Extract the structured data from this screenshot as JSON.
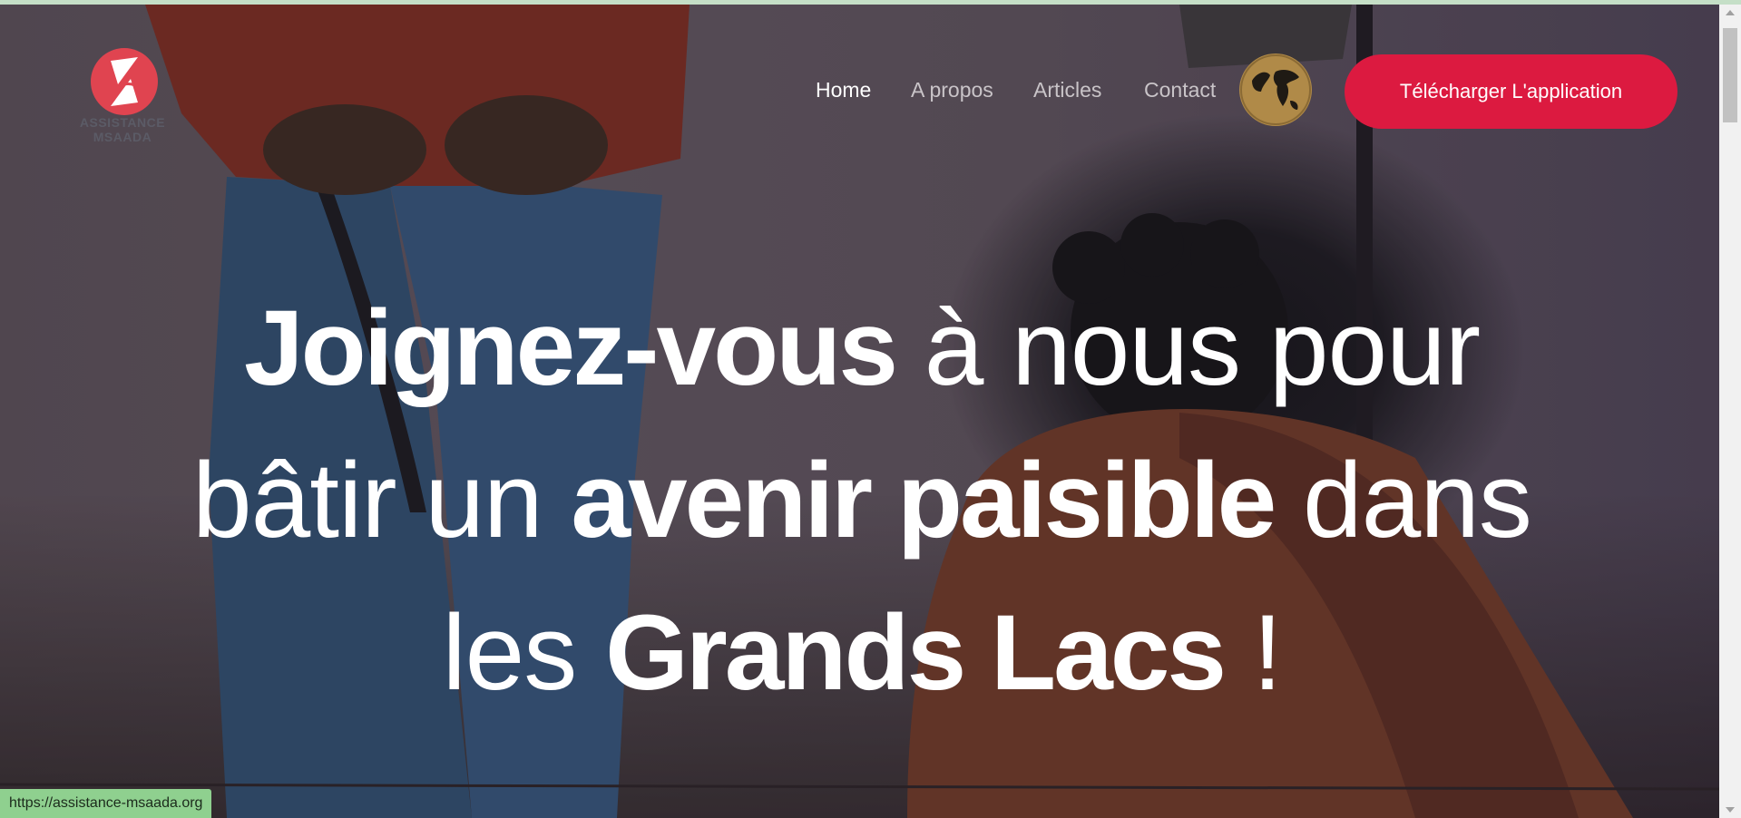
{
  "header": {
    "logo_text": "ASSISTANCE MSAADA",
    "nav": [
      {
        "label": "Home",
        "active": true
      },
      {
        "label": "A propos",
        "active": false
      },
      {
        "label": "Articles",
        "active": false
      },
      {
        "label": "Contact",
        "active": false
      }
    ],
    "language_icon": "globe-icon",
    "cta_label": "Télécharger L'application"
  },
  "hero": {
    "line1": {
      "bold": "Joignez-vous",
      "light": " à nous pour"
    },
    "line2": {
      "light_a": "bâtir un ",
      "bold": "avenir paisible",
      "light_b": " dans"
    },
    "line3": {
      "light_a": "les ",
      "bold": "Grands Lacs",
      "light_b": " !"
    }
  },
  "statusbar": {
    "url": "https://assistance-msaada.org"
  },
  "colors": {
    "accent": "#dc1a40",
    "logo": "#e04450",
    "globe": "#b08a48",
    "statusbar": "#8fd08f"
  }
}
